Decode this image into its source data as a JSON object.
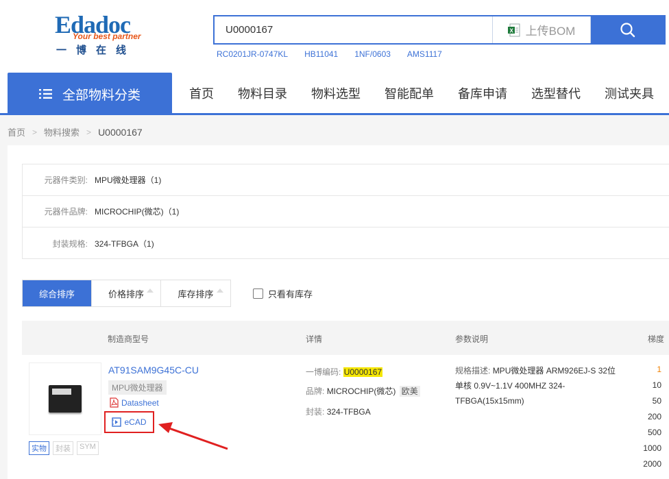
{
  "header": {
    "logo_main": "Edadoc",
    "logo_tagline": "Your best partner",
    "logo_cn": "一博在线",
    "search_value": "U0000167",
    "bom_label": "上传BOM",
    "hot_links": [
      "RC0201JR-0747KL",
      "HB11041",
      "1NF/0603",
      "AMS1117"
    ]
  },
  "nav": {
    "category_label": "全部物料分类",
    "items": [
      "首页",
      "物料目录",
      "物料选型",
      "智能配单",
      "备库申请",
      "选型替代",
      "测试夹具"
    ]
  },
  "breadcrumb": [
    "首页",
    "物料搜索",
    "U0000167"
  ],
  "filters": [
    {
      "label": "元器件类别:",
      "value": "MPU微处理器（1)"
    },
    {
      "label": "元器件品牌:",
      "value": "MICROCHIP(微芯)（1)"
    },
    {
      "label": "封装规格:",
      "value": "324-TFBGA（1)"
    }
  ],
  "sort": {
    "buttons": [
      "综合排序",
      "价格排序",
      "库存排序"
    ],
    "stock_only": "只看有库存"
  },
  "table": {
    "headers": [
      "制造商型号",
      "详情",
      "参数说明",
      "梯度"
    ]
  },
  "product": {
    "part_number": "AT91SAM9G45C-CU",
    "type": "MPU微处理器",
    "datasheet": "Datasheet",
    "ecad": "eCAD",
    "tags": [
      "实物",
      "封装",
      "SYM"
    ],
    "code_label": "一博编码:",
    "code_value": "U0000167",
    "brand_label": "品牌:",
    "brand_value": "MICROCHIP(微芯)",
    "region": "欧美",
    "package_label": "封装:",
    "package_value": "324-TFBGA",
    "param_label": "规格描述:",
    "param_value": "MPU微处理器 ARM926EJ-S 32位 单核 0.9V~1.1V 400MHZ 324-TFBGA(15x15mm)",
    "ladder": [
      "1",
      "10",
      "50",
      "200",
      "500",
      "1000",
      "2000"
    ]
  },
  "colors": {
    "primary": "#3c71d6",
    "highlight": "#f5e600",
    "annotation": "#e02020"
  }
}
